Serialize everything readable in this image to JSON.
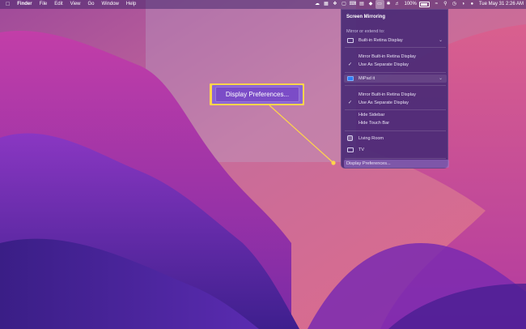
{
  "menubar": {
    "apple_icon": "apple-icon",
    "app_name": "Finder",
    "menus": [
      "File",
      "Edit",
      "View",
      "Go",
      "Window",
      "Help"
    ],
    "battery_percent": "100%",
    "datetime": "Tue May 31  2:26 AM"
  },
  "screen_mirroring": {
    "title": "Screen Mirroring",
    "section_label": "Mirror or extend to:",
    "display_1": {
      "name": "Built-in Retina Display",
      "options": [
        "Mirror Built-in Retina Display",
        "Use As Separate Display"
      ],
      "checked": "Use As Separate Display"
    },
    "display_2": {
      "name": "MiPad it",
      "options": [
        "Mirror Built-in Retina Display",
        "Use As Separate Display"
      ],
      "checked": "Use As Separate Display"
    },
    "sidebar_options": [
      "Hide Sidebar",
      "Hide Touch Bar"
    ],
    "airplay_devices": [
      "Living Room",
      "TV"
    ],
    "footer": "Display Preferences..."
  },
  "callout": {
    "label": "Display Preferences...",
    "color": "#ffd54a"
  },
  "colors": {
    "menu_bg": "#4a2a76",
    "highlight": "#ffd54a",
    "accent": "#2f7df6"
  }
}
